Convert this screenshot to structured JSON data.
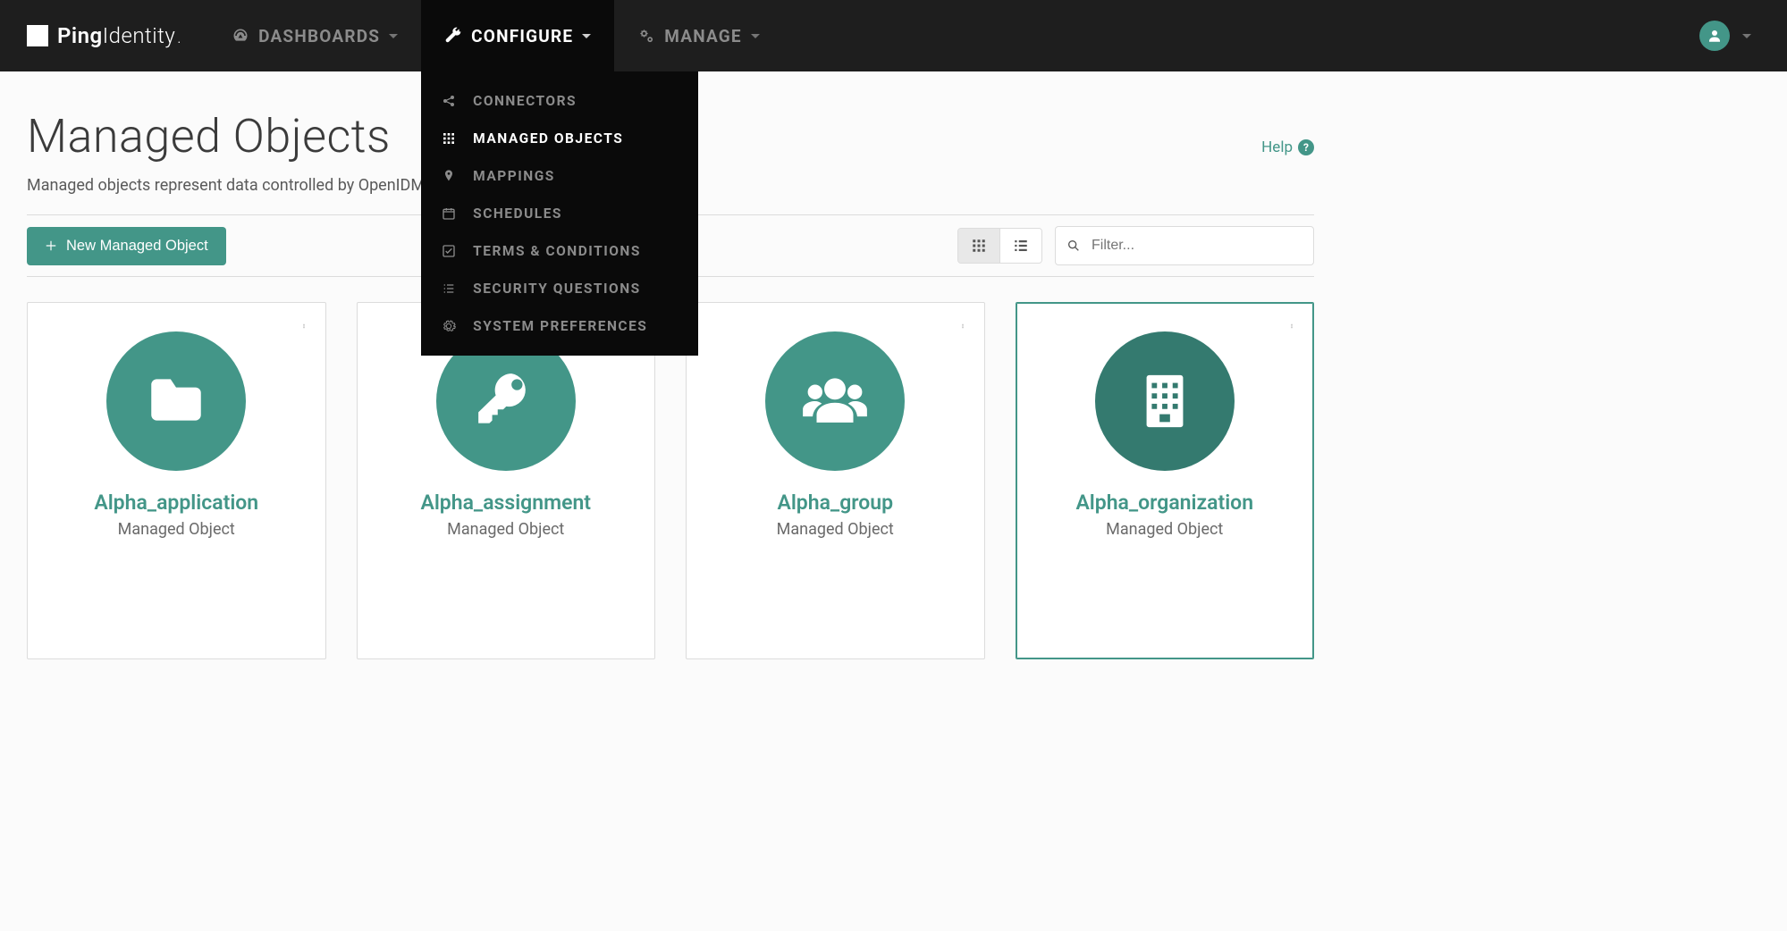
{
  "brand": {
    "name_bold": "Ping",
    "name_light": "Identity",
    "tm": "."
  },
  "nav": {
    "items": [
      {
        "label": "DASHBOARDS",
        "icon": "dashboard-icon"
      },
      {
        "label": "CONFIGURE",
        "icon": "wrench-icon"
      },
      {
        "label": "MANAGE",
        "icon": "gears-icon"
      }
    ]
  },
  "dropdown": {
    "items": [
      {
        "label": "CONNECTORS",
        "icon": "connectors-icon"
      },
      {
        "label": "MANAGED OBJECTS",
        "icon": "grid-icon"
      },
      {
        "label": "MAPPINGS",
        "icon": "pin-icon"
      },
      {
        "label": "SCHEDULES",
        "icon": "calendar-icon"
      },
      {
        "label": "TERMS & CONDITIONS",
        "icon": "checkbox-icon"
      },
      {
        "label": "SECURITY QUESTIONS",
        "icon": "list-icon"
      },
      {
        "label": "SYSTEM PREFERENCES",
        "icon": "cog-icon"
      }
    ]
  },
  "page": {
    "title": "Managed Objects",
    "description": "Managed objects represent data controlled by OpenIDM",
    "help": "Help",
    "new_button": "New Managed Object",
    "filter_placeholder": "Filter..."
  },
  "cards": [
    {
      "title": "Alpha_application",
      "subtitle": "Managed Object",
      "icon": "folder-icon"
    },
    {
      "title": "Alpha_assignment",
      "subtitle": "Managed Object",
      "icon": "key-icon"
    },
    {
      "title": "Alpha_group",
      "subtitle": "Managed Object",
      "icon": "users-icon"
    },
    {
      "title": "Alpha_organization",
      "subtitle": "Managed Object",
      "icon": "building-icon"
    }
  ]
}
